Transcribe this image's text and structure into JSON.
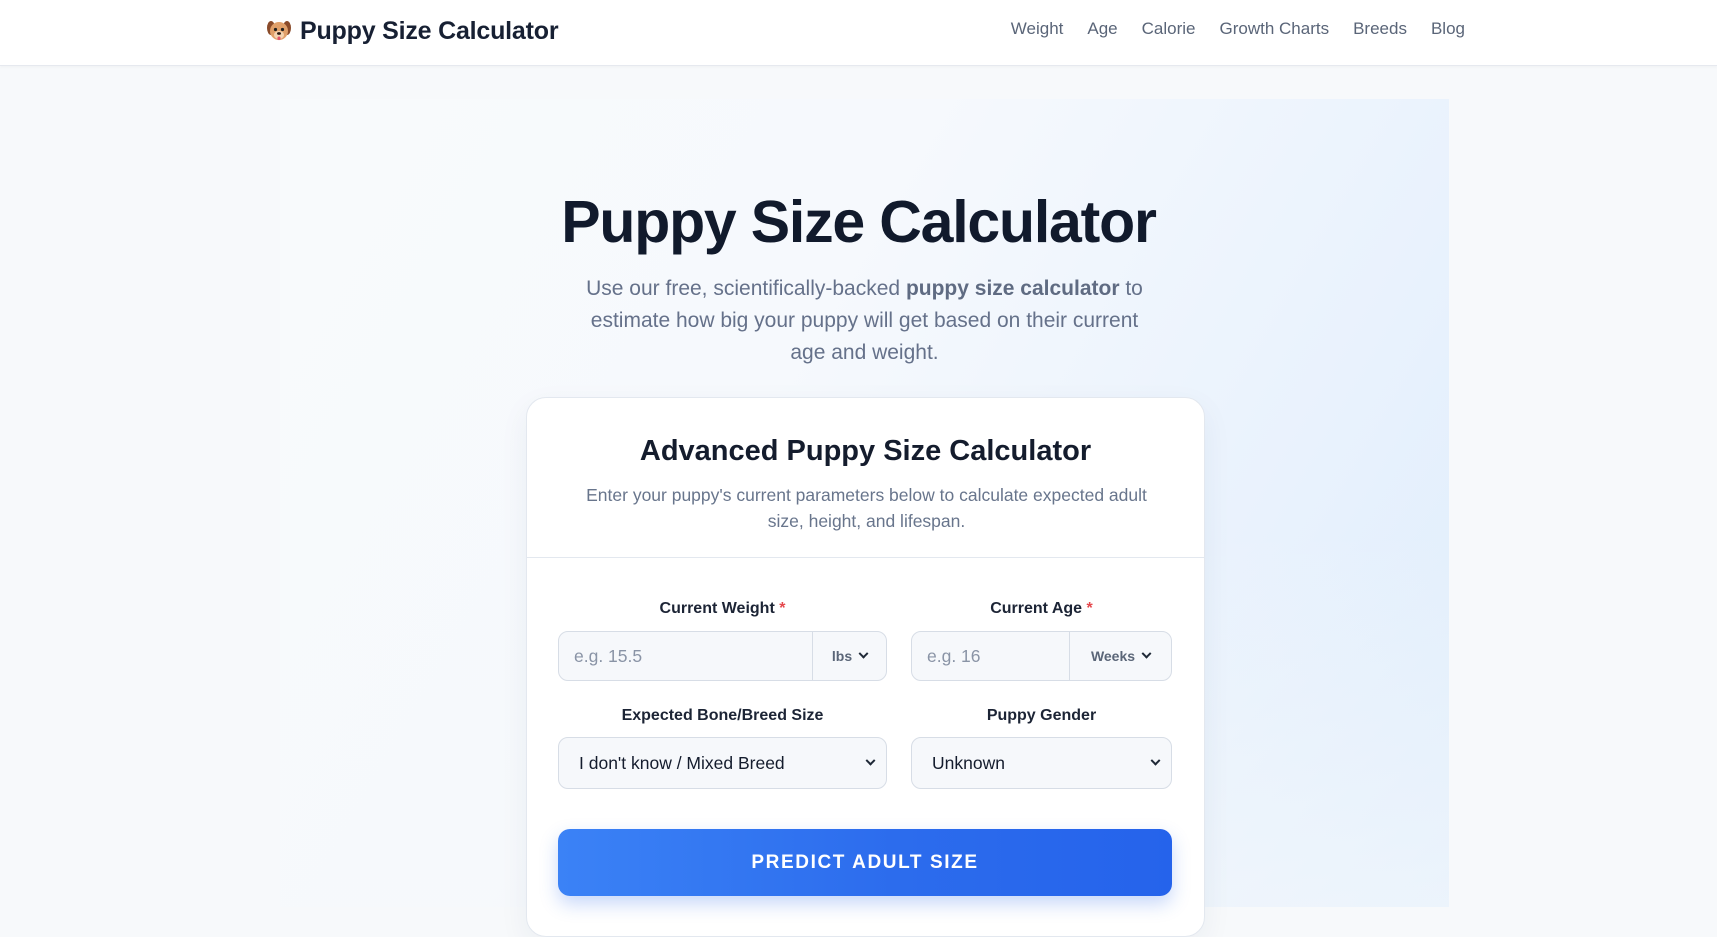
{
  "header": {
    "brand_title": "Puppy Size Calculator",
    "brand_icon": "puppy-face-icon",
    "nav": [
      "Weight",
      "Age",
      "Calorie",
      "Growth Charts",
      "Breeds",
      "Blog"
    ]
  },
  "hero": {
    "title": "Puppy Size Calculator",
    "subtitle_before": "Use our free, scientifically-backed ",
    "subtitle_bold": "puppy size calculator",
    "subtitle_after": " to estimate how big your puppy will get based on their current age and weight."
  },
  "card": {
    "title": "Advanced Puppy Size Calculator",
    "subtitle": "Enter your puppy's current parameters below to calculate expected adult size, height, and lifespan.",
    "weight": {
      "label": "Current Weight",
      "required_mark": "*",
      "placeholder": "e.g. 15.5",
      "unit": "lbs"
    },
    "age": {
      "label": "Current Age",
      "required_mark": "*",
      "placeholder": "e.g. 16",
      "unit": "Weeks"
    },
    "breed_size": {
      "label": "Expected Bone/Breed Size",
      "selected": "I don't know / Mixed Breed"
    },
    "gender": {
      "label": "Puppy Gender",
      "selected": "Unknown"
    },
    "submit_label": "PREDICT ADULT SIZE"
  },
  "colors": {
    "accent": "#2563eb",
    "accent_light": "#3b82f6",
    "required": "#e5484d",
    "heading": "#111a2c",
    "muted_text": "#65718a"
  }
}
